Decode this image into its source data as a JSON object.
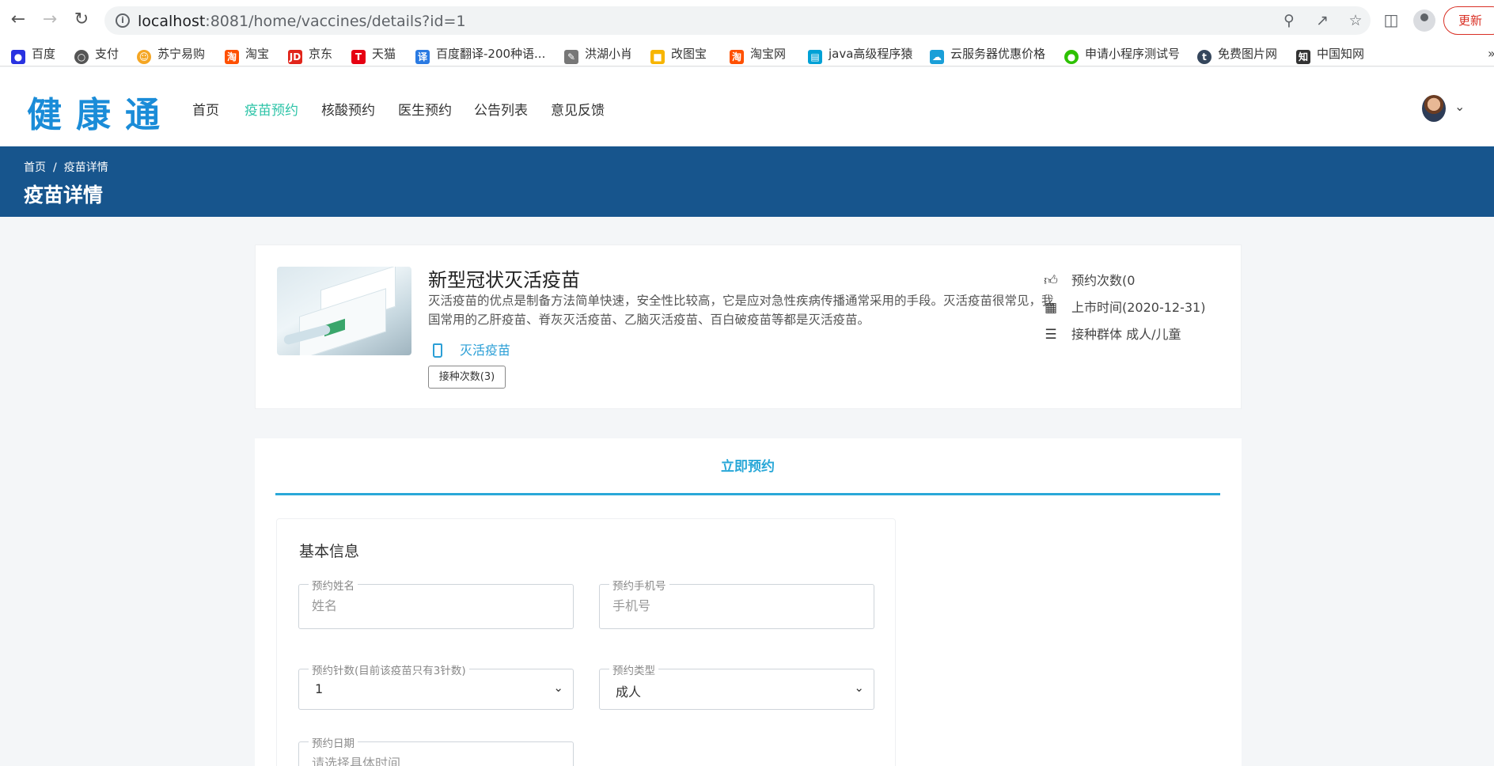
{
  "browser": {
    "url_host": "localhost",
    "url_rest": ":8081/home/vaccines/details?id=1",
    "update_label": "更新"
  },
  "bookmarks": [
    {
      "label": "百度",
      "icon": "paw-icon",
      "color": "#2932e1"
    },
    {
      "label": "支付",
      "icon": "globe-icon",
      "color": "#555555"
    },
    {
      "label": "苏宁易购",
      "icon": "lion-icon",
      "color": "#f5a623"
    },
    {
      "label": "淘宝",
      "icon": "taobao-icon",
      "color": "#ff5000"
    },
    {
      "label": "京东",
      "icon": "jd-icon",
      "color": "#e1251b"
    },
    {
      "label": "天猫",
      "icon": "tmall-icon",
      "color": "#e60012"
    },
    {
      "label": "百度翻译-200种语...",
      "icon": "translate-icon",
      "color": "#2a7ae2"
    },
    {
      "label": "洪湖小肖",
      "icon": "pen-icon",
      "color": "#666666"
    },
    {
      "label": "改图宝",
      "icon": "image-icon",
      "color": "#f7b500"
    },
    {
      "label": "淘宝网",
      "icon": "taobao-icon",
      "color": "#ff5000"
    },
    {
      "label": "java高级程序猿",
      "icon": "bilibili-icon",
      "color": "#00a1d6"
    },
    {
      "label": "云服务器优惠价格",
      "icon": "cloud-icon",
      "color": "#1a9fd8"
    },
    {
      "label": "申请小程序测试号",
      "icon": "wechat-icon",
      "color": "#2dc100"
    },
    {
      "label": "免费图片网",
      "icon": "t-icon",
      "color": "#35465c"
    },
    {
      "label": "中国知网",
      "icon": "cnki-icon",
      "color": "#333333"
    }
  ],
  "site": {
    "logo": "健康通",
    "nav": [
      "首页",
      "疫苗预约",
      "核酸预约",
      "医生预约",
      "公告列表",
      "意见反馈"
    ],
    "active_nav": "疫苗预约"
  },
  "banner": {
    "crumb_home": "首页",
    "crumb_sep": "/",
    "crumb_current": "疫苗详情",
    "title": "疫苗详情"
  },
  "vaccine": {
    "name": "新型冠状灭活疫苗",
    "description": "灭活疫苗的优点是制备方法简单快速，安全性比较高，它是应对急性疾病传播通常采用的手段。灭活疫苗很常见，我国常用的乙肝疫苗、脊灰灭活疫苗、乙脑灭活疫苗、百白破疫苗等都是灭活疫苗。",
    "type": "灭活疫苗",
    "doses_badge": "接种次数(3)",
    "reservations": "预约次数(0",
    "launch_date": "上市时间(2020-12-31)",
    "target_group": "接种群体 成人/儿童"
  },
  "booking": {
    "tab": "立即预约",
    "form_title": "基本信息",
    "name_label": "预约姓名",
    "name_placeholder": "姓名",
    "phone_label": "预约手机号",
    "phone_placeholder": "手机号",
    "dose_label": "预约针数(目前该疫苗只有3针数)",
    "dose_value": "1",
    "type_label": "预约类型",
    "type_value": "成人",
    "date_label": "预约日期",
    "date_placeholder": "请选择具体时间"
  }
}
